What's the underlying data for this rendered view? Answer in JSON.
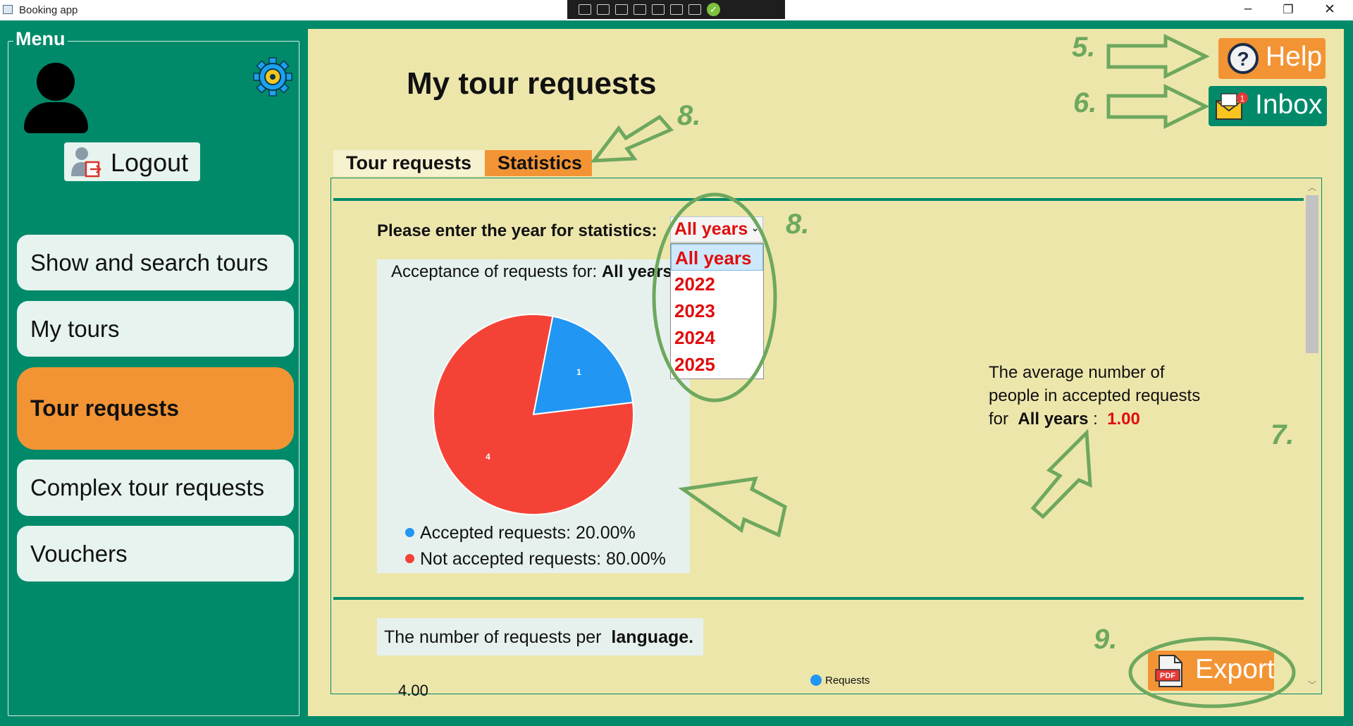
{
  "window": {
    "title": "Booking app",
    "minimize": "–",
    "restore": "❐",
    "close": "✕"
  },
  "menu": {
    "legend": "Menu",
    "logout_label": "Logout",
    "items": [
      {
        "label": "Show and search tours"
      },
      {
        "label": "My tours"
      },
      {
        "label": "Tour requests"
      },
      {
        "label": "Complex tour requests"
      },
      {
        "label": "Vouchers"
      }
    ],
    "active_index": 2
  },
  "page": {
    "title": "My tour requests"
  },
  "header_buttons": {
    "help_label": "Help",
    "inbox_label": "Inbox",
    "inbox_badge": "1"
  },
  "tabs": [
    {
      "label": "Tour requests"
    },
    {
      "label": "Statistics"
    }
  ],
  "active_tab": "Statistics",
  "statistics": {
    "year_prompt": "Please enter the year for statistics:",
    "year_selected": "All years",
    "year_options": [
      "All years",
      "2022",
      "2023",
      "2024",
      "2025"
    ],
    "acceptance_title_prefix": "Acceptance of requests for: ",
    "acceptance_title_value": "All years",
    "average_text_line1": "The average number of",
    "average_text_line2": "people in accepted requests",
    "average_text_for": "for",
    "average_year": "All years",
    "average_colon": ":",
    "average_value": "1.00",
    "language_title_prefix": "The number of  requests per ",
    "language_title_bold": "language.",
    "language_legend": "Requests",
    "language_y_top_tick": "4.00"
  },
  "chart_data": {
    "type": "pie",
    "title": "Acceptance of requests for: All years",
    "slices": [
      {
        "label": "Accepted requests: 20.00%",
        "value": 1,
        "color": "#2196f3"
      },
      {
        "label": "Not accepted requests: 80.00%",
        "value": 4,
        "color": "#f44336"
      }
    ]
  },
  "export": {
    "label": "Export",
    "icon_text": "PDF"
  },
  "annotations": {
    "help": "5.",
    "inbox": "6.",
    "tab": "8.",
    "dropdown": "8.",
    "average": "7.",
    "export": "9."
  },
  "colors": {
    "app_green": "#018a6a",
    "content_bg": "#ede6ab",
    "accent_orange": "#f39434",
    "annotation_green": "#6da85e",
    "value_red": "#e00d0d"
  }
}
